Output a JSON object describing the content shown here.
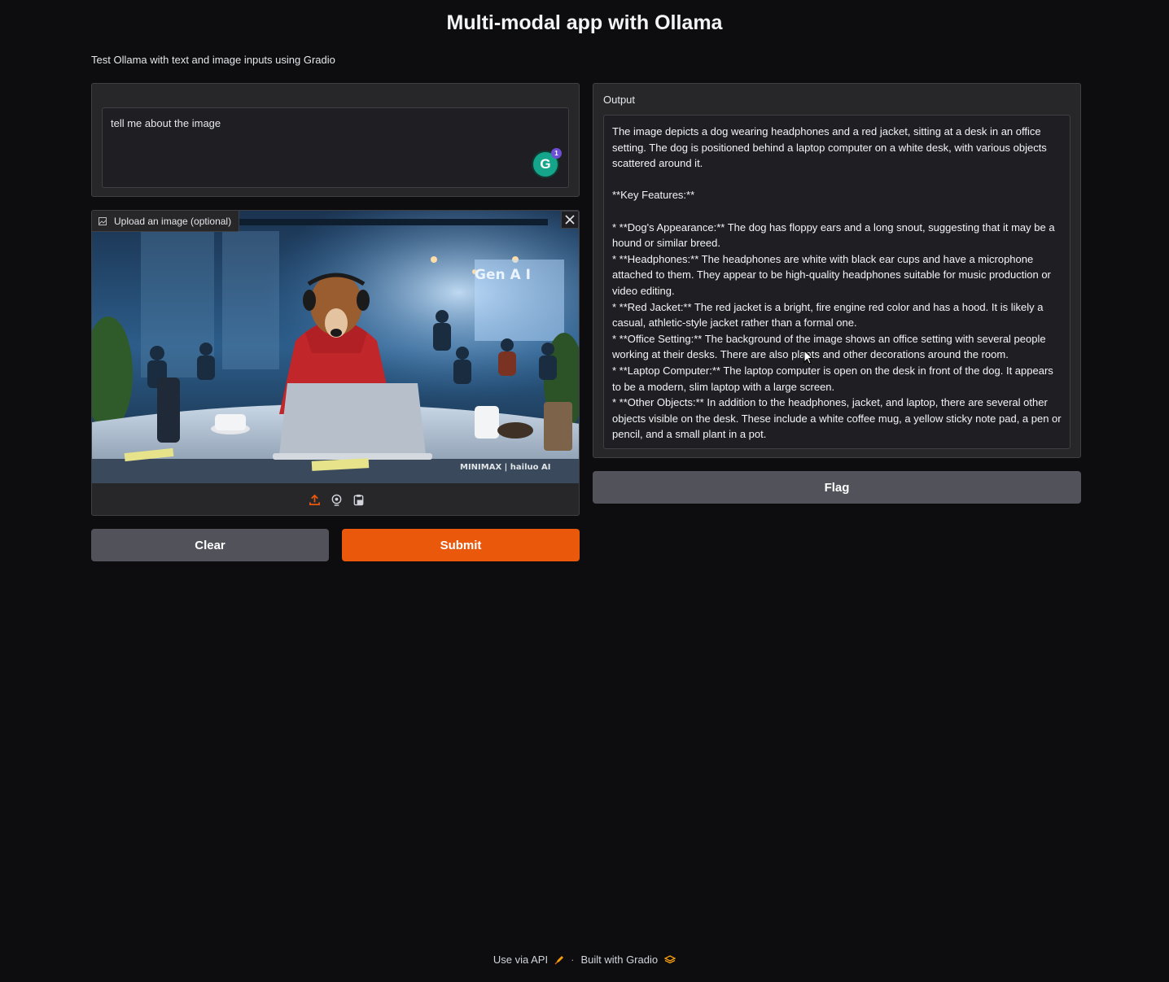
{
  "header": {
    "title": "Multi-modal app with Ollama",
    "description": "Test Ollama with text and image inputs using Gradio"
  },
  "text_input": {
    "value": "tell me about the image",
    "grammarly_badge": "1"
  },
  "image_input": {
    "label": "Upload an image (optional)",
    "photo_sign_text": "Gen A I",
    "watermark": "MINIMAX | hailuo AI",
    "tools": [
      "upload-icon",
      "webcam-icon",
      "clipboard-icon"
    ]
  },
  "buttons": {
    "clear": "Clear",
    "submit": "Submit",
    "flag": "Flag"
  },
  "output": {
    "label": "Output",
    "lines": [
      "The image depicts a dog wearing headphones and a red jacket, sitting at a desk in an office setting. The dog is positioned behind a laptop computer on a white desk, with various objects scattered around it.",
      "",
      "**Key Features:**",
      "",
      "* **Dog's Appearance:** The dog has floppy ears and a long snout, suggesting that it may be a hound or similar breed.",
      "* **Headphones:** The headphones are white with black ear cups and have a microphone attached to them. They appear to be high-quality headphones suitable for music production or video editing.",
      "* **Red Jacket:** The red jacket is a bright, fire engine red color and has a hood. It is likely a casual, athletic-style jacket rather than a formal one.",
      "* **Office Setting:** The background of the image shows an office setting with several people working at their desks. There are also plants and other decorations around the room.",
      "* **Laptop Computer:** The laptop computer is open on the desk in front of the dog. It appears to be a modern, slim laptop with a large screen.",
      "* **Other Objects:** In addition to the headphones, jacket, and laptop, there are several other objects visible on the desk. These include a white coffee mug, a yellow sticky note pad, a pen or pencil, and a small plant in a pot."
    ]
  },
  "footer": {
    "api": "Use via API",
    "separator": "·",
    "built": "Built with Gradio"
  },
  "colors": {
    "accent": "#ea580c",
    "background": "#0d0d10",
    "panel": "#27272a",
    "secondary_button": "#52525b"
  }
}
